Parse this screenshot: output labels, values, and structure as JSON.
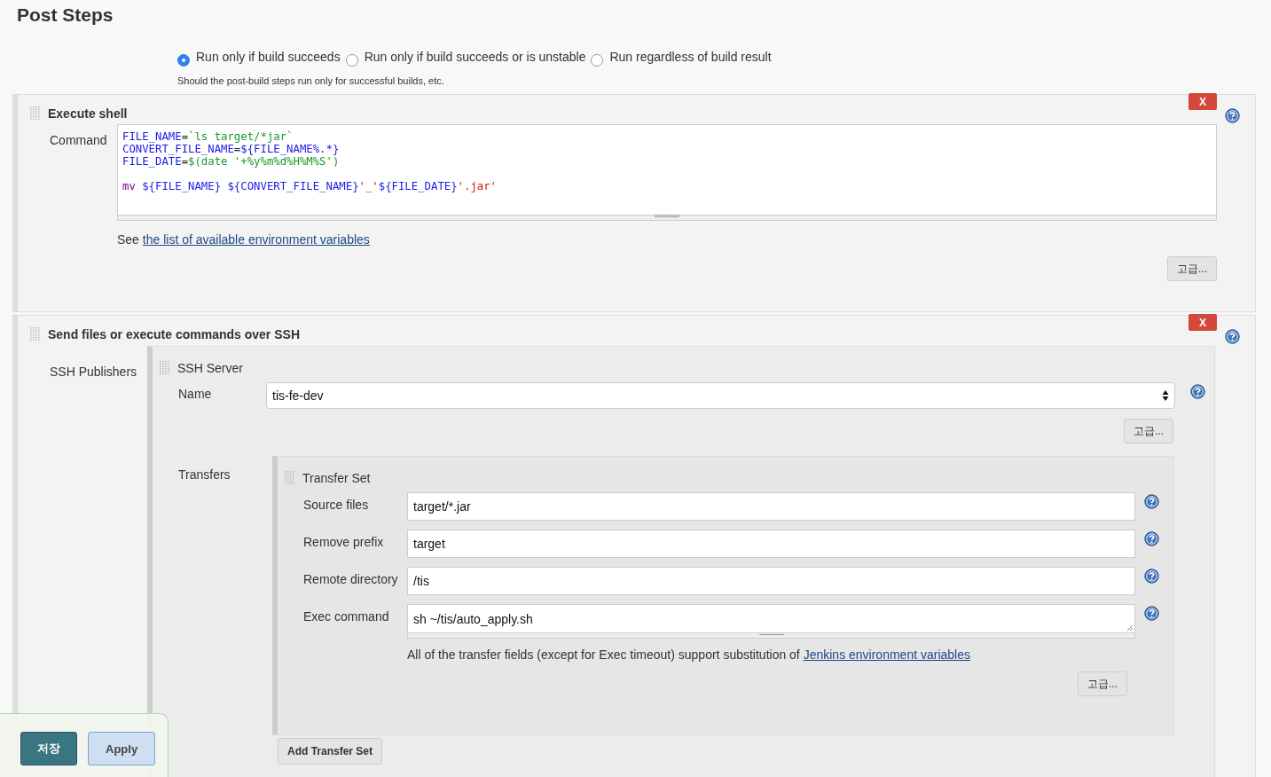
{
  "page_title": "Post Steps",
  "run_options": [
    {
      "label": "Run only if build succeeds",
      "selected": true
    },
    {
      "label": "Run only if build succeeds or is unstable",
      "selected": false
    },
    {
      "label": "Run regardless of build result",
      "selected": false
    }
  ],
  "run_hint": "Should the post-build steps run only for successful builds, etc.",
  "steps": [
    {
      "kind": "shell",
      "title": "Execute shell",
      "delete": "X",
      "command_label": "Command",
      "code": [
        {
          "tokens": [
            {
              "kind": "var",
              "text": "FILE_NAME"
            },
            {
              "kind": "op",
              "text": "="
            },
            {
              "kind": "str",
              "text": "`ls target/*jar`"
            }
          ]
        },
        {
          "tokens": [
            {
              "kind": "var",
              "text": "CONVERT_FILE_NAME"
            },
            {
              "kind": "op",
              "text": "="
            },
            {
              "kind": "var",
              "text": "${FILE_NAME%.*}"
            }
          ]
        },
        {
          "tokens": [
            {
              "kind": "var",
              "text": "FILE_DATE"
            },
            {
              "kind": "op",
              "text": "="
            },
            {
              "kind": "str",
              "text": "$(date '+%y%m%d%H%M%S')"
            }
          ]
        },
        {
          "blank_before": true,
          "tokens": [
            {
              "kind": "cmd",
              "text": "mv "
            },
            {
              "kind": "var",
              "text": "${FILE_NAME} ${CONVERT_FILE_NAME}"
            },
            {
              "kind": "lit",
              "text": "'_'"
            },
            {
              "kind": "var",
              "text": "${FILE_DATE}"
            },
            {
              "kind": "lit",
              "text": "'.jar'"
            }
          ]
        }
      ],
      "see_text": "See",
      "see_link": "the list of available environment variables",
      "advanced": "고급..."
    },
    {
      "kind": "ssh",
      "title": "Send files or execute commands over SSH",
      "delete": "X",
      "publishers_label": "SSH Publishers",
      "server": {
        "title": "SSH Server",
        "name_label": "Name",
        "name_value": "tis-fe-dev",
        "advanced": "고급...",
        "transfers_label": "Transfers",
        "transfer_set": {
          "title": "Transfer Set",
          "fields": [
            {
              "kind": "input",
              "label": "Source files",
              "value": "target/*.jar"
            },
            {
              "kind": "input",
              "label": "Remove prefix",
              "value": "target"
            },
            {
              "kind": "input",
              "label": "Remote directory",
              "value": "/tis"
            },
            {
              "kind": "textarea",
              "label": "Exec command",
              "value": "sh ~/tis/auto_apply.sh"
            }
          ],
          "note": "All of the transfer fields (except for Exec timeout) support substitution of",
          "note_link": "Jenkins environment variables",
          "advanced": "고급..."
        },
        "add_button": "Add Transfer Set"
      }
    }
  ],
  "footer": {
    "buttons": [
      {
        "kind": "primary",
        "label": "저장"
      },
      {
        "kind": "secondary",
        "label": "Apply"
      }
    ]
  }
}
